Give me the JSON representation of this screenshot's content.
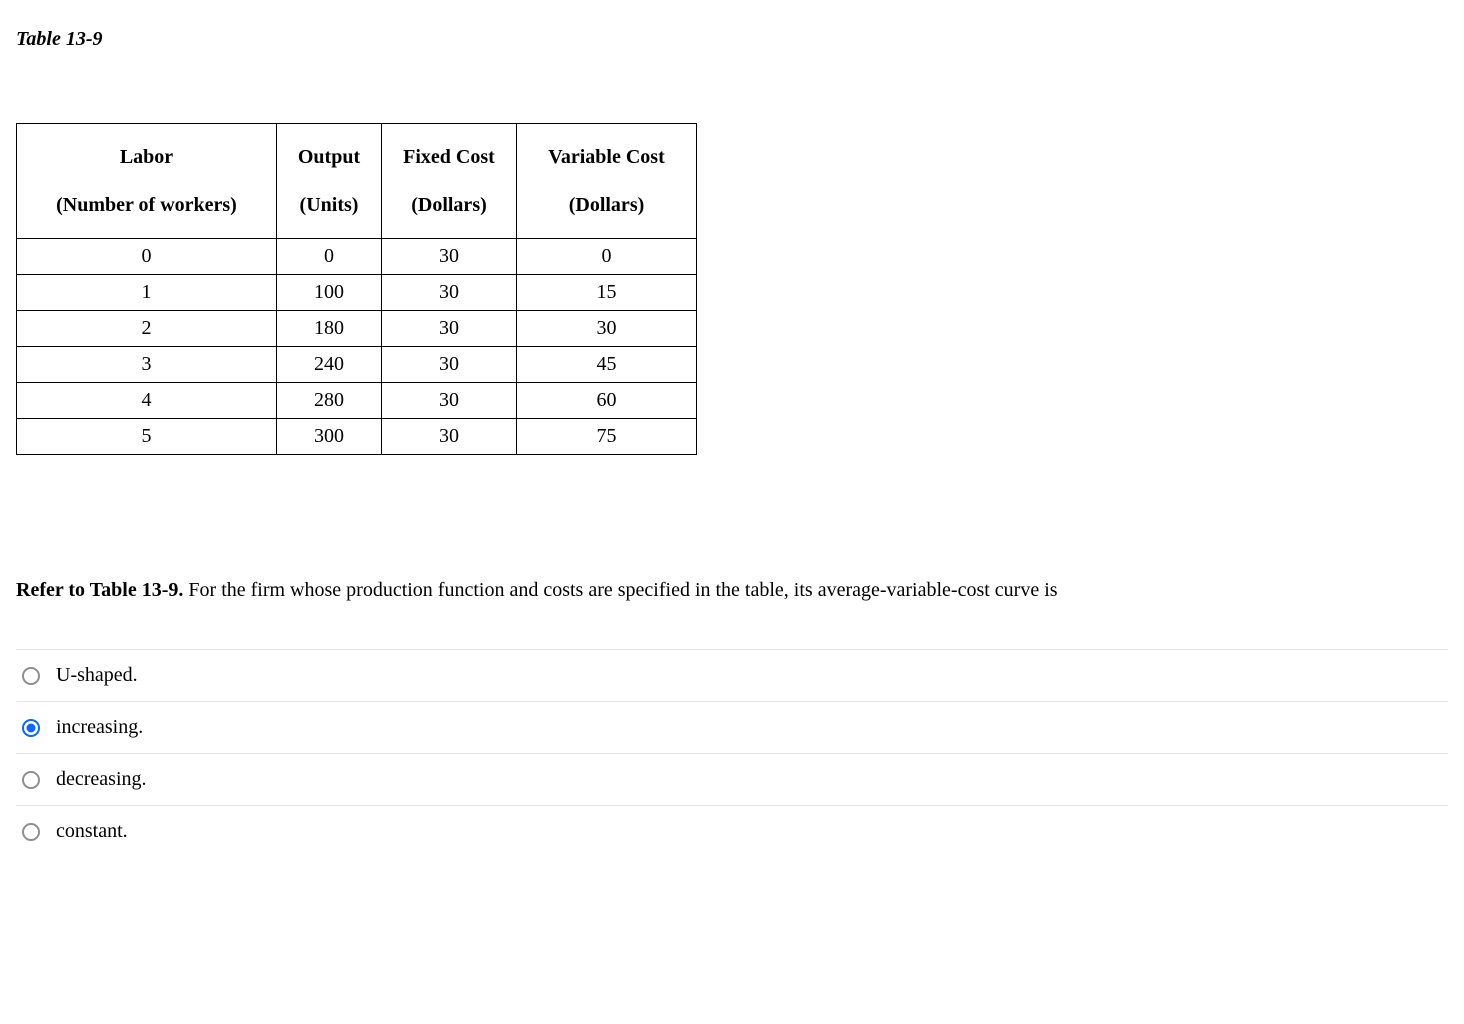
{
  "title": "Table 13-9",
  "table": {
    "headers": [
      {
        "main": "Labor",
        "sub": "(Number of workers)"
      },
      {
        "main": "Output",
        "sub": "(Units)"
      },
      {
        "main": "Fixed Cost",
        "sub": "(Dollars)"
      },
      {
        "main": "Variable Cost",
        "sub": "(Dollars)"
      }
    ],
    "rows": [
      {
        "labor": "0",
        "output": "0",
        "fixed": "30",
        "variable": "0"
      },
      {
        "labor": "1",
        "output": "100",
        "fixed": "30",
        "variable": "15"
      },
      {
        "labor": "2",
        "output": "180",
        "fixed": "30",
        "variable": "30"
      },
      {
        "labor": "3",
        "output": "240",
        "fixed": "30",
        "variable": "45"
      },
      {
        "labor": "4",
        "output": "280",
        "fixed": "30",
        "variable": "60"
      },
      {
        "labor": "5",
        "output": "300",
        "fixed": "30",
        "variable": "75"
      }
    ]
  },
  "question": {
    "bold": "Refer to Table 13-9.",
    "rest": " For the firm whose production function and costs are specified in the table, its average-variable-cost curve is"
  },
  "options": [
    {
      "label": "U-shaped.",
      "selected": false
    },
    {
      "label": "increasing.",
      "selected": true
    },
    {
      "label": "decreasing.",
      "selected": false
    },
    {
      "label": "constant.",
      "selected": false
    }
  ]
}
